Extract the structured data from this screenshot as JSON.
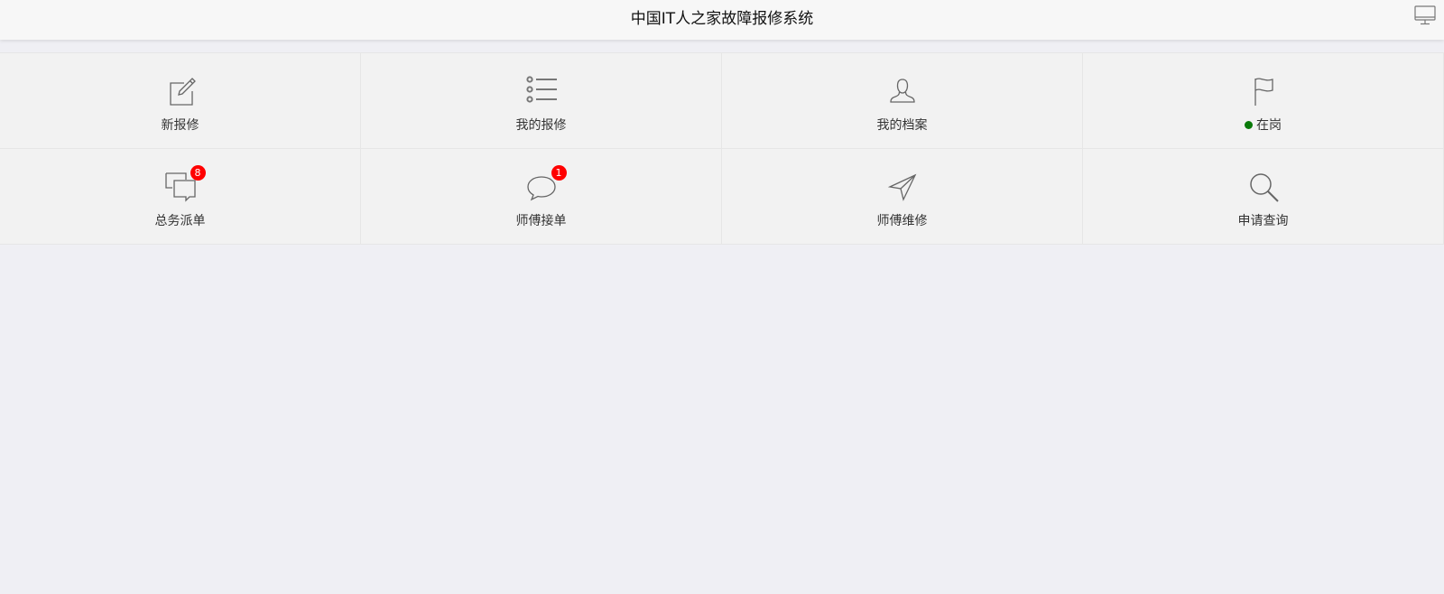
{
  "header": {
    "title": "中国IT人之家故障报修系统",
    "right_icon": "desktop-icon"
  },
  "menu": [
    {
      "label": "新报修",
      "icon": "edit-icon"
    },
    {
      "label": "我的报修",
      "icon": "list-icon"
    },
    {
      "label": "我的档案",
      "icon": "user-icon"
    },
    {
      "label": "在岗",
      "icon": "flag-icon",
      "status_color": "#0a7a0a"
    },
    {
      "label": "总务派单",
      "icon": "chat-bubbles-icon",
      "badge": "8"
    },
    {
      "label": "师傅接单",
      "icon": "chat-icon",
      "badge": "1"
    },
    {
      "label": "师傅维修",
      "icon": "send-icon"
    },
    {
      "label": "申请查询",
      "icon": "search-icon"
    }
  ],
  "colors": {
    "badge": "#ff0000",
    "background": "#efeff4",
    "header": "#f7f7f7"
  }
}
